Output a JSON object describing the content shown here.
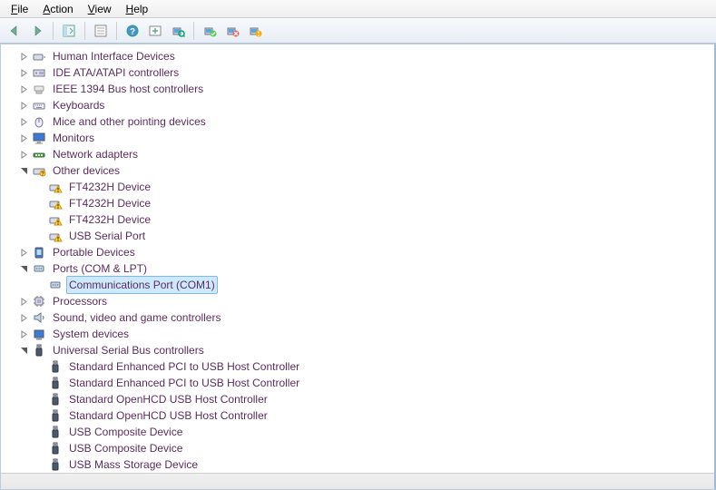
{
  "menu": {
    "file": "File",
    "action": "Action",
    "view": "View",
    "help": "Help"
  },
  "tree": [
    {
      "id": "hid",
      "label": "Human Interface Devices",
      "icon": "hid",
      "expanded": false,
      "depth": 1
    },
    {
      "id": "ide",
      "label": "IDE ATA/ATAPI controllers",
      "icon": "ide",
      "expanded": false,
      "depth": 1
    },
    {
      "id": "ieee1394",
      "label": "IEEE 1394 Bus host controllers",
      "icon": "1394",
      "expanded": false,
      "depth": 1
    },
    {
      "id": "keyboards",
      "label": "Keyboards",
      "icon": "kbd",
      "expanded": false,
      "depth": 1
    },
    {
      "id": "mice",
      "label": "Mice and other pointing devices",
      "icon": "mouse",
      "expanded": false,
      "depth": 1
    },
    {
      "id": "monitors",
      "label": "Monitors",
      "icon": "monitor",
      "expanded": false,
      "depth": 1
    },
    {
      "id": "network",
      "label": "Network adapters",
      "icon": "net",
      "expanded": false,
      "depth": 1
    },
    {
      "id": "other",
      "label": "Other devices",
      "icon": "other",
      "expanded": true,
      "depth": 1,
      "children": [
        {
          "label": "FT4232H Device",
          "icon": "warn",
          "depth": 2,
          "leaf": true
        },
        {
          "label": "FT4232H Device",
          "icon": "warn",
          "depth": 2,
          "leaf": true
        },
        {
          "label": "FT4232H Device",
          "icon": "warn",
          "depth": 2,
          "leaf": true
        },
        {
          "label": "USB Serial Port",
          "icon": "warn",
          "depth": 2,
          "leaf": true
        }
      ]
    },
    {
      "id": "portable",
      "label": "Portable Devices",
      "icon": "portable",
      "expanded": false,
      "depth": 1
    },
    {
      "id": "ports",
      "label": "Ports (COM & LPT)",
      "icon": "port",
      "expanded": true,
      "depth": 1,
      "children": [
        {
          "label": "Communications Port (COM1)",
          "icon": "port",
          "depth": 2,
          "leaf": true,
          "selected": true
        }
      ]
    },
    {
      "id": "proc",
      "label": "Processors",
      "icon": "cpu",
      "expanded": false,
      "depth": 1
    },
    {
      "id": "sound",
      "label": "Sound, video and game controllers",
      "icon": "sound",
      "expanded": false,
      "depth": 1
    },
    {
      "id": "system",
      "label": "System devices",
      "icon": "sys",
      "expanded": false,
      "depth": 1
    },
    {
      "id": "usb",
      "label": "Universal Serial Bus controllers",
      "icon": "usb",
      "expanded": true,
      "depth": 1,
      "children": [
        {
          "label": "Standard Enhanced PCI to USB Host Controller",
          "icon": "usb",
          "depth": 2,
          "leaf": true
        },
        {
          "label": "Standard Enhanced PCI to USB Host Controller",
          "icon": "usb",
          "depth": 2,
          "leaf": true
        },
        {
          "label": "Standard OpenHCD USB Host Controller",
          "icon": "usb",
          "depth": 2,
          "leaf": true
        },
        {
          "label": "Standard OpenHCD USB Host Controller",
          "icon": "usb",
          "depth": 2,
          "leaf": true
        },
        {
          "label": "USB Composite Device",
          "icon": "usb",
          "depth": 2,
          "leaf": true
        },
        {
          "label": "USB Composite Device",
          "icon": "usb",
          "depth": 2,
          "leaf": true
        },
        {
          "label": "USB Mass Storage Device",
          "icon": "usb",
          "depth": 2,
          "leaf": true
        }
      ]
    }
  ]
}
